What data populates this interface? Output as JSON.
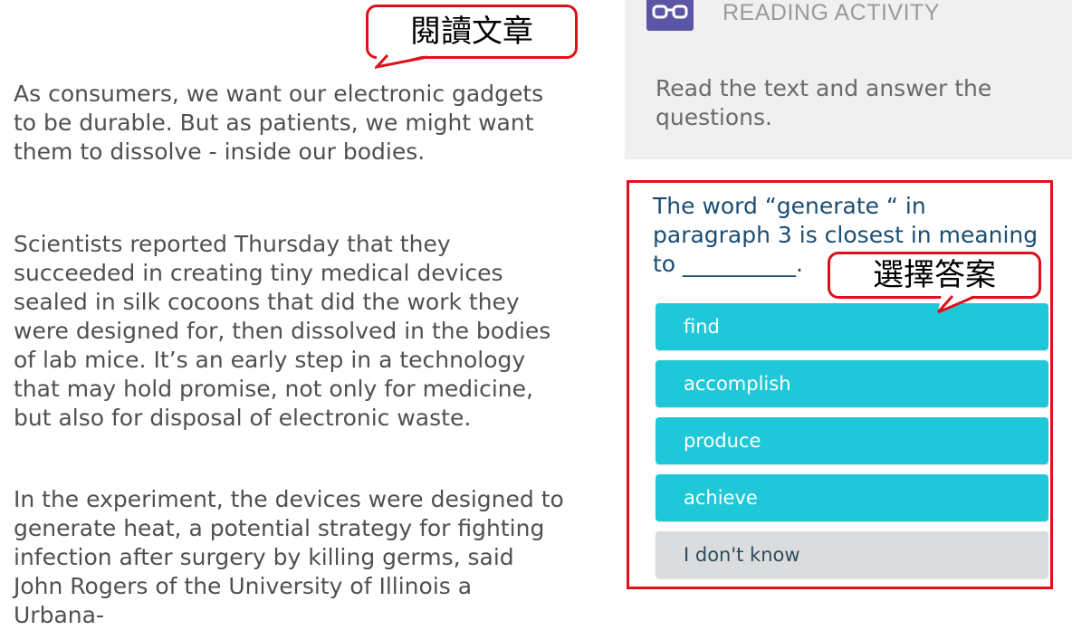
{
  "article": {
    "paragraphs": [
      "As consumers, we want our electronic gadgets to be durable. But as patients, we might want them to dissolve  - inside our bodies.",
      "Scientists reported Thursday that they succeeded in creating tiny medical devices sealed in silk cocoons that did the work they were designed for, then dissolved in the bodies of lab mice. It’s an early step in a technology that may hold promise, not only for medicine, but also for disposal of electronic waste.",
      "In the experiment, the devices were designed to generate heat, a potential strategy for fighting infection after surgery by killing germs, said John Rogers of the University of Illinois a Urbana-"
    ]
  },
  "callouts": {
    "read_article": "閱讀文章",
    "choose_answer": "選擇答案"
  },
  "activity": {
    "icon": "glasses-icon",
    "title": "READING ACTIVITY",
    "instruction": "Read the text and answer the questions."
  },
  "question": {
    "text": "The word “generate “ in paragraph 3 is closest in meaning to __________.",
    "options": [
      "find",
      "accomplish",
      "produce",
      "achieve",
      "I don't know"
    ]
  },
  "colors": {
    "callout_border": "#e0101a",
    "question_border": "#e3101b",
    "option_bg": "#1ec8d8",
    "option_neutral_bg": "#dadcdd",
    "icon_bg": "#5b55a5",
    "question_text": "#1a4d73"
  }
}
